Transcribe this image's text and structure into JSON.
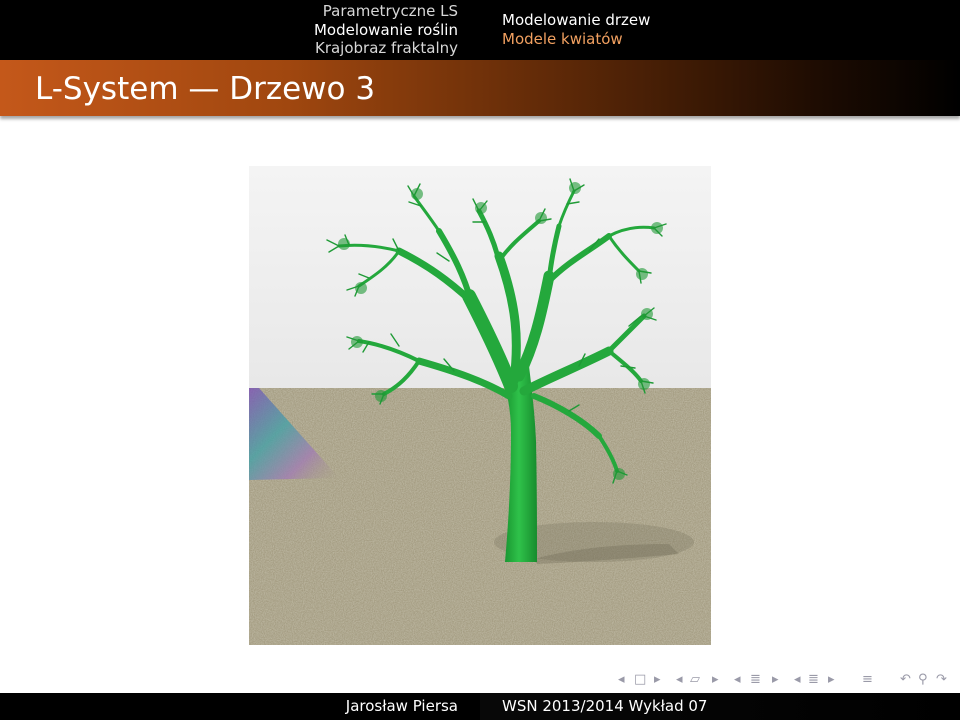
{
  "header": {
    "sections": [
      {
        "label": "Parametryczne LS",
        "active": false
      },
      {
        "label": "Modelowanie roślin",
        "active": true
      },
      {
        "label": "Krajobraz fraktalny",
        "active": false
      }
    ],
    "subsections": [
      {
        "label": "Modelowanie drzew",
        "active": true
      },
      {
        "label": "Modele kwiatów",
        "active": false
      }
    ]
  },
  "frame": {
    "title": "L-System — Drzewo 3"
  },
  "navigation_symbols": {
    "icons": [
      "nav-prev-icon",
      "nav-frame-icon",
      "nav-next-icon",
      "nav-prev-subsection-icon",
      "nav-subsection-icon",
      "nav-next-subsection-icon",
      "nav-prev-section-icon",
      "nav-section-icon",
      "nav-next-section-icon",
      "nav-align-icon",
      "nav-back-icon",
      "nav-find-icon",
      "nav-forward-icon"
    ],
    "glyphs": {
      "prev": "◂",
      "next": "▸",
      "frame": "□",
      "subsection": "▱",
      "section": "≣",
      "align": "≡",
      "back": "↶",
      "find": "⚲",
      "forward": "↷"
    }
  },
  "footer": {
    "author": "Jarosław Piersa",
    "course": "WSN 2013/2014 Wykład 07"
  },
  "colors": {
    "accent": "#c4581a",
    "subsection_accent": "#f1a060",
    "tree_green": "#22a83a",
    "ground": "#a39b80"
  }
}
